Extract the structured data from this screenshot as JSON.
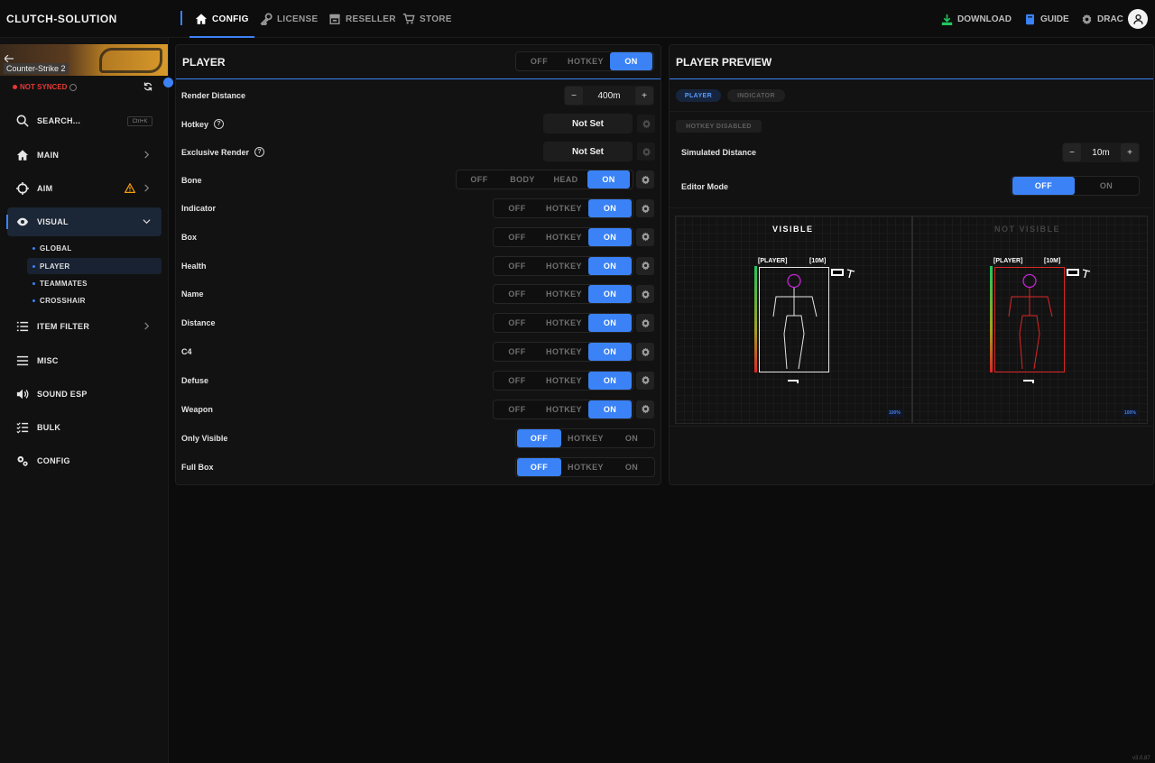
{
  "app": {
    "brand": "CLUTCH-SOLUTION",
    "version": "v3.0.87"
  },
  "nav": {
    "tabs": [
      {
        "label": "CONFIG",
        "icon": "home-icon",
        "active": true
      },
      {
        "label": "LICENSE",
        "icon": "key-icon"
      },
      {
        "label": "RESELLER",
        "icon": "store-icon"
      },
      {
        "label": "STORE",
        "icon": "cart-icon"
      }
    ],
    "download": "DOWNLOAD",
    "guide": "GUIDE",
    "user": "DRAC"
  },
  "sidebar": {
    "game": "Counter-Strike 2",
    "sync_status": "NOT SYNCED",
    "search": {
      "label": "SEARCH...",
      "shortcut": "Ctrl+K"
    },
    "items": [
      {
        "label": "MAIN",
        "icon": "home-icon"
      },
      {
        "label": "AIM",
        "icon": "crosshair-icon"
      },
      {
        "label": "VISUAL",
        "icon": "eye-icon"
      },
      {
        "label": "ITEM FILTER",
        "icon": "list-icon"
      },
      {
        "label": "MISC",
        "icon": "menu-icon"
      },
      {
        "label": "SOUND ESP",
        "icon": "speaker-icon"
      },
      {
        "label": "BULK",
        "icon": "checklist-icon"
      },
      {
        "label": "CONFIG",
        "icon": "gears-icon"
      }
    ],
    "visual_sub": [
      "GLOBAL",
      "PLAYER",
      "TEAMMATES",
      "CROSSHAIR"
    ]
  },
  "player": {
    "title": "PLAYER",
    "header_toggle": {
      "options": [
        "OFF",
        "HOTKEY",
        "ON"
      ],
      "selected": "ON"
    },
    "render_distance": {
      "label": "Render Distance",
      "value": "400m",
      "minus": "−",
      "plus": "+"
    },
    "hotkey": {
      "label": "Hotkey",
      "value": "Not Set"
    },
    "exclusive_render": {
      "label": "Exclusive Render",
      "value": "Not Set"
    },
    "bone": {
      "label": "Bone",
      "options": [
        "OFF",
        "BODY",
        "HEAD",
        "ON"
      ],
      "selected": "ON"
    },
    "rows": [
      {
        "label": "Indicator",
        "selected": "ON"
      },
      {
        "label": "Box",
        "selected": "ON"
      },
      {
        "label": "Health",
        "selected": "ON"
      },
      {
        "label": "Name",
        "selected": "ON"
      },
      {
        "label": "Distance",
        "selected": "ON"
      },
      {
        "label": "C4",
        "selected": "ON"
      },
      {
        "label": "Defuse",
        "selected": "ON"
      },
      {
        "label": "Weapon",
        "selected": "ON"
      }
    ],
    "rows2": [
      {
        "label": "Only Visible",
        "selected": "OFF"
      },
      {
        "label": "Full Box",
        "selected": "OFF"
      }
    ],
    "tri_options": [
      "OFF",
      "HOTKEY",
      "ON"
    ]
  },
  "preview": {
    "title": "PLAYER PREVIEW",
    "tabs": [
      "PLAYER",
      "INDICATOR"
    ],
    "hotkey_badge": "HOTKEY DISABLED",
    "simulated_distance": {
      "label": "Simulated Distance",
      "value": "10m",
      "minus": "−",
      "plus": "+"
    },
    "editor_mode": {
      "label": "Editor Mode",
      "options": [
        "OFF",
        "ON"
      ],
      "selected": "OFF"
    },
    "visible_label": "VISIBLE",
    "not_visible_label": "NOT VISIBLE",
    "name_tag": "[PLAYER]",
    "distance_tag": "[10M]",
    "zoom": "100%"
  },
  "colors": {
    "accent": "#3b82f6",
    "warning": "#f59e0b",
    "visible_skeleton": "#e5e5e5",
    "visible_head": "#c026d3",
    "hidden": "#dc2626"
  }
}
